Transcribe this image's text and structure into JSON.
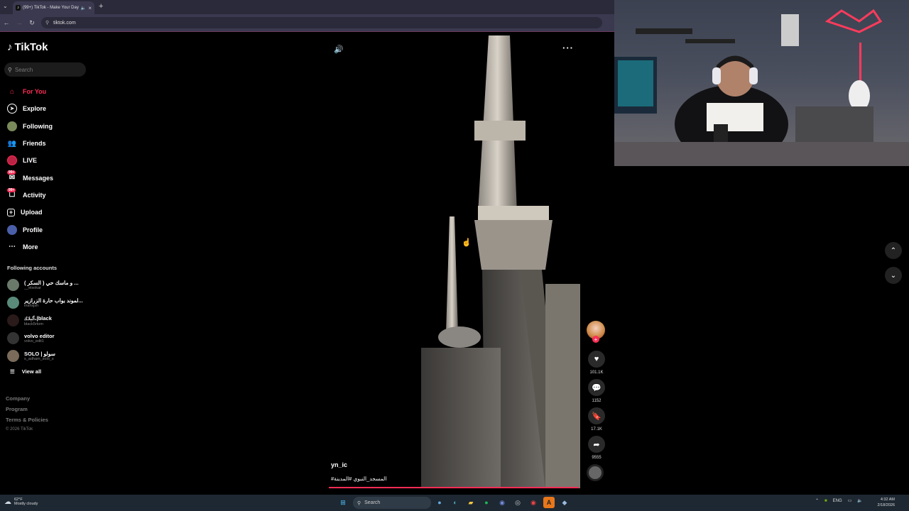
{
  "browser": {
    "tab_title": "(99+) TikTok - Make Your Day",
    "url": "tiktok.com"
  },
  "sidebar": {
    "logo_text": "TikTok",
    "search_placeholder": "Search",
    "nav": [
      {
        "label": "For You",
        "icon": "home-icon",
        "active": true
      },
      {
        "label": "Explore",
        "icon": "compass-icon"
      },
      {
        "label": "Following",
        "icon": "following-avatar-icon"
      },
      {
        "label": "Friends",
        "icon": "friends-icon"
      },
      {
        "label": "LIVE",
        "icon": "live-icon"
      },
      {
        "label": "Messages",
        "icon": "messages-icon",
        "badge": "99+"
      },
      {
        "label": "Activity",
        "icon": "activity-icon",
        "badge": "99+"
      },
      {
        "label": "Upload",
        "icon": "upload-icon"
      },
      {
        "label": "Profile",
        "icon": "profile-avatar-icon"
      },
      {
        "label": "More",
        "icon": "more-icon"
      }
    ],
    "following_header": "Following accounts",
    "following": [
      {
        "name": "( السكر ) و ماسك حي ...",
        "user": "__elsokar"
      },
      {
        "name": "لموند بواب حارة الزرازير...",
        "user": "inahsjsh"
      },
      {
        "name": "ۦآلبلاك|black",
        "user": "black5rtom"
      },
      {
        "name": "volvo editor",
        "user": "volvo_edit1"
      },
      {
        "name": "SOLO | سولو",
        "user": "s_adham_solo_s"
      }
    ],
    "view_all": "View all",
    "footer": [
      "Company",
      "Program",
      "Terms & Policies"
    ],
    "copyright": "© 2026 TikTok"
  },
  "video": {
    "author": "yn_ic",
    "caption": "#المسجد_النبوي #المدينة",
    "progress": 1.0,
    "likes": "101.1K",
    "comments": "1152",
    "saves": "17.1K",
    "shares": "9555"
  },
  "taskbar": {
    "temp": "62°F",
    "weather": "Mostly cloudy",
    "search": "Search",
    "lang": "ENG",
    "time": "4:32 AM",
    "date": "2/18/2026"
  }
}
